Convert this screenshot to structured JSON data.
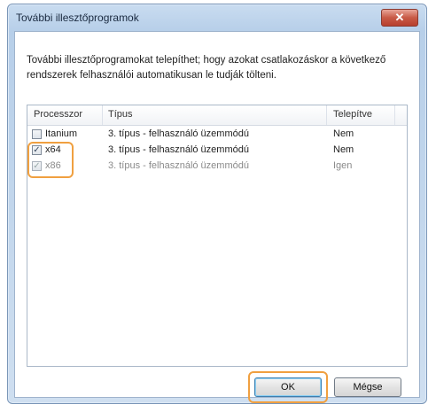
{
  "window": {
    "title": "További illesztőprogramok",
    "close_label": "✕"
  },
  "description": "További illesztőprogramokat telepíthet; hogy azokat csatlakozáskor a következő rendszerek felhasználói automatikusan le tudják tölteni.",
  "table": {
    "headers": {
      "processor": "Processzor",
      "type": "Típus",
      "installed": "Telepítve"
    },
    "rows": [
      {
        "processor": "Itanium",
        "type": "3. típus - felhasználó üzemmódú",
        "installed": "Nem",
        "checked": false,
        "disabled": false
      },
      {
        "processor": "x64",
        "type": "3. típus - felhasználó üzemmódú",
        "installed": "Nem",
        "checked": true,
        "disabled": false
      },
      {
        "processor": "x86",
        "type": "3. típus - felhasználó üzemmódú",
        "installed": "Igen",
        "checked": true,
        "disabled": true
      }
    ]
  },
  "buttons": {
    "ok": "OK",
    "cancel": "Mégse"
  },
  "colors": {
    "highlight": "#f0a040",
    "titlebar": "#b7cfe9",
    "close": "#c85a46"
  }
}
